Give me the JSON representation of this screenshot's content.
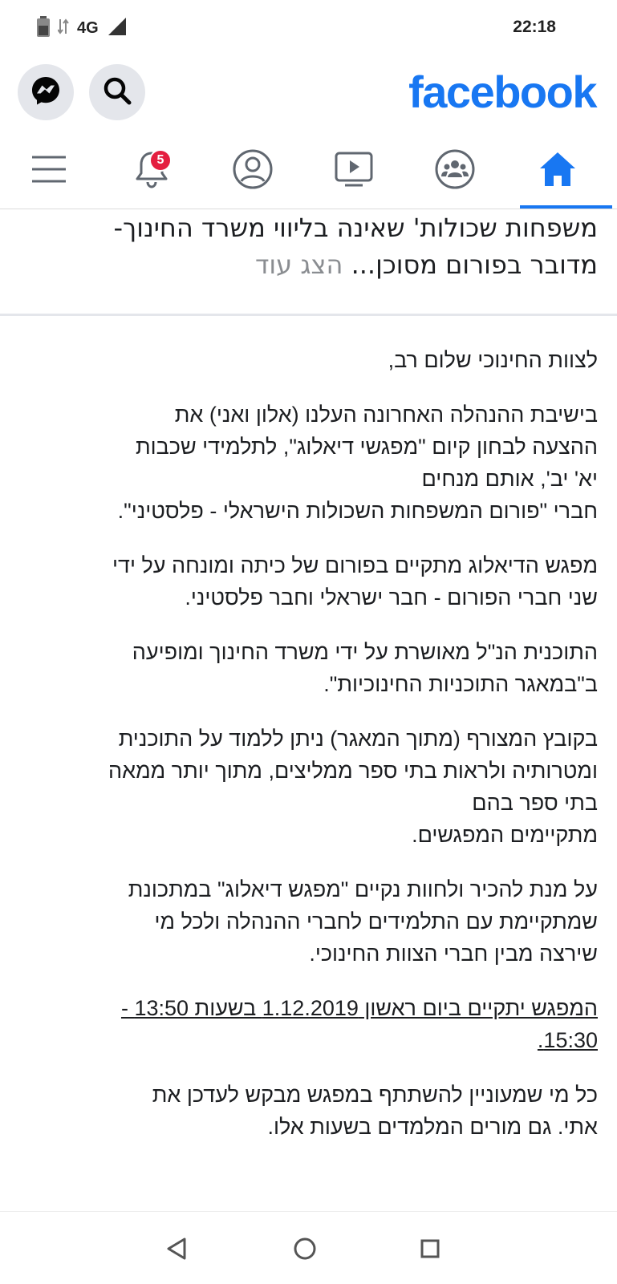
{
  "status_bar": {
    "network": "4G",
    "time": "22:18"
  },
  "header": {
    "logo": "facebook",
    "icons": [
      "messenger-icon",
      "search-icon"
    ]
  },
  "tabs": [
    {
      "name": "home",
      "icon": "home-icon",
      "active": true
    },
    {
      "name": "groups",
      "icon": "groups-icon"
    },
    {
      "name": "watch",
      "icon": "video-icon"
    },
    {
      "name": "profile",
      "icon": "profile-icon"
    },
    {
      "name": "notifications",
      "icon": "bell-icon",
      "badge": "5"
    },
    {
      "name": "menu",
      "icon": "menu-icon"
    }
  ],
  "post": {
    "line1": "משפחות שכולות' שאינה בליווי משרד החינוך-",
    "line2": "מדובר בפורום מסוכן...",
    "see_more": "הצג עוד"
  },
  "body": {
    "p1": "לצוות החינוכי שלום רב,",
    "p2": "בישיבת ההנהלה האחרונה העלנו (אלון ואני) את\nההצעה לבחון קיום \"מפגשי דיאלוג\", לתלמידי שכבות\nיא' יב', אותם מנחים\nחברי \"פורום המשפחות השכולות הישראלי - פלסטיני\".",
    "p3": "מפגש הדיאלוג מתקיים בפורום של כיתה ומונחה על ידי\nשני חברי הפורום - חבר ישראלי וחבר פלסטיני.",
    "p4": "התוכנית הנ\"ל מאושרת על ידי משרד החינוך ומופיעה\nב\"במאגר התוכניות החינוכיות\".",
    "p5": "בקובץ המצורף (מתוך המאגר) ניתן ללמוד על התוכנית\nומטרותיה ולראות בתי ספר ממליצים, מתוך יותר ממאה\nבתי ספר בהם\nמתקיימים המפגשים.",
    "p6": "על מנת להכיר ולחוות נקיים \"מפגש דיאלוג\" במתכונת\nשמתקיימת עם התלמידים לחברי ההנהלה ולכל מי\nשירצה מבין חברי הצוות החינוכי.",
    "p7": "המפגש יתקיים ביום ראשון 1.12.2019 בשעות 13:50 -\n15:30.",
    "p8": "כל מי שמעוניין להשתתף במפגש מבקש לעדכן את\nאתי. גם מורים המלמדים בשעות אלו."
  },
  "nav_bar": [
    "back-icon",
    "home-circle-icon",
    "recents-icon"
  ],
  "colors": {
    "brand": "#1877f2",
    "badge": "#e41e3f",
    "see_more": "#8a8d91"
  }
}
